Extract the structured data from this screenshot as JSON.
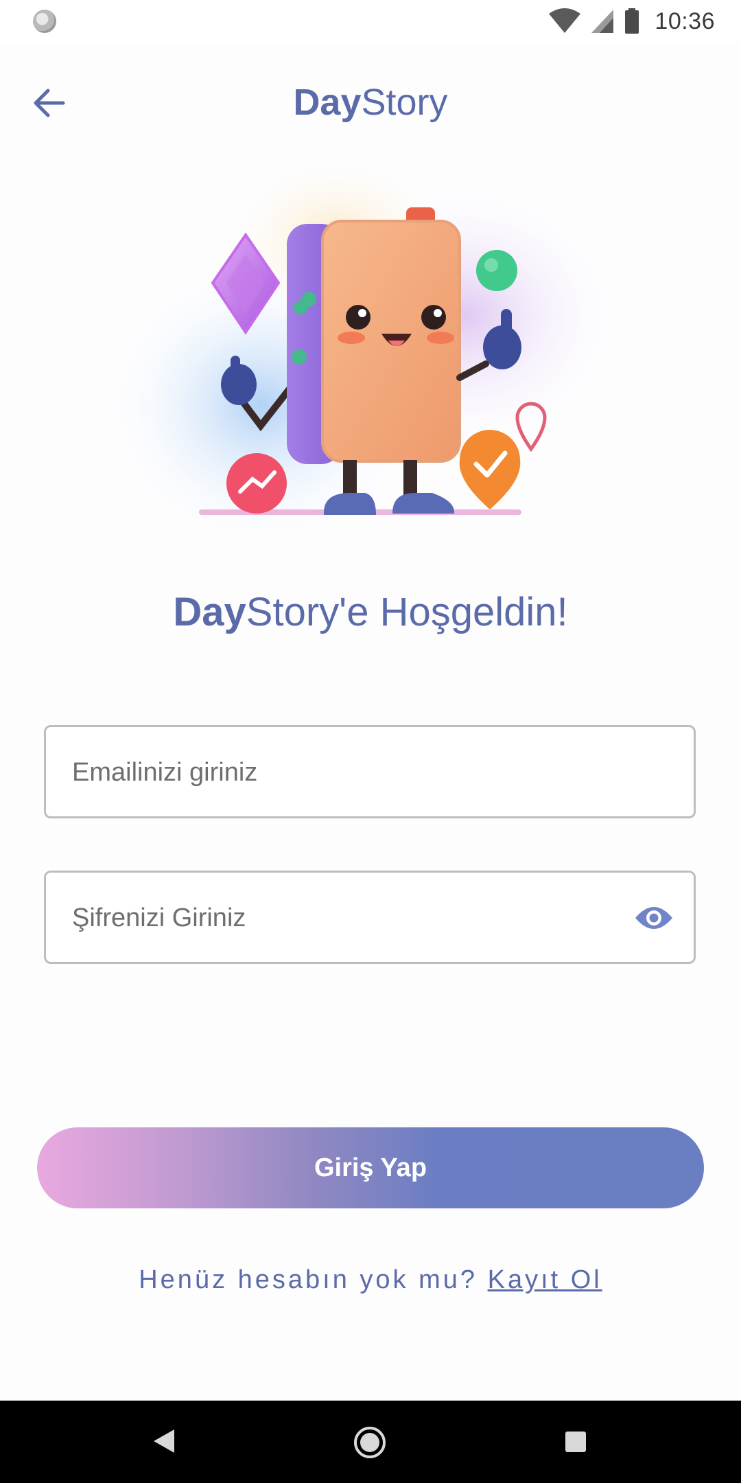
{
  "status_bar": {
    "time": "10:36",
    "icons": [
      "wifi-icon",
      "signal-icon",
      "battery-icon"
    ]
  },
  "header": {
    "back_icon": "arrow-left-icon",
    "title_bold": "Day",
    "title_regular": "Story"
  },
  "welcome": {
    "bold": "Day",
    "regular": "Story'e Hoşgeldin!"
  },
  "form": {
    "email_placeholder": "Emailinizi giriniz",
    "password_placeholder": "Şifrenizi Giriniz",
    "eye_icon": "eye-icon",
    "login_label": "Giriş Yap"
  },
  "register": {
    "prompt": "Henüz hesabın yok mu? ",
    "link": "Kayıt Ol"
  },
  "colors": {
    "primary": "#5b6aa9",
    "gradient_start": "#e8a9df",
    "gradient_end": "#6a7fc2"
  }
}
